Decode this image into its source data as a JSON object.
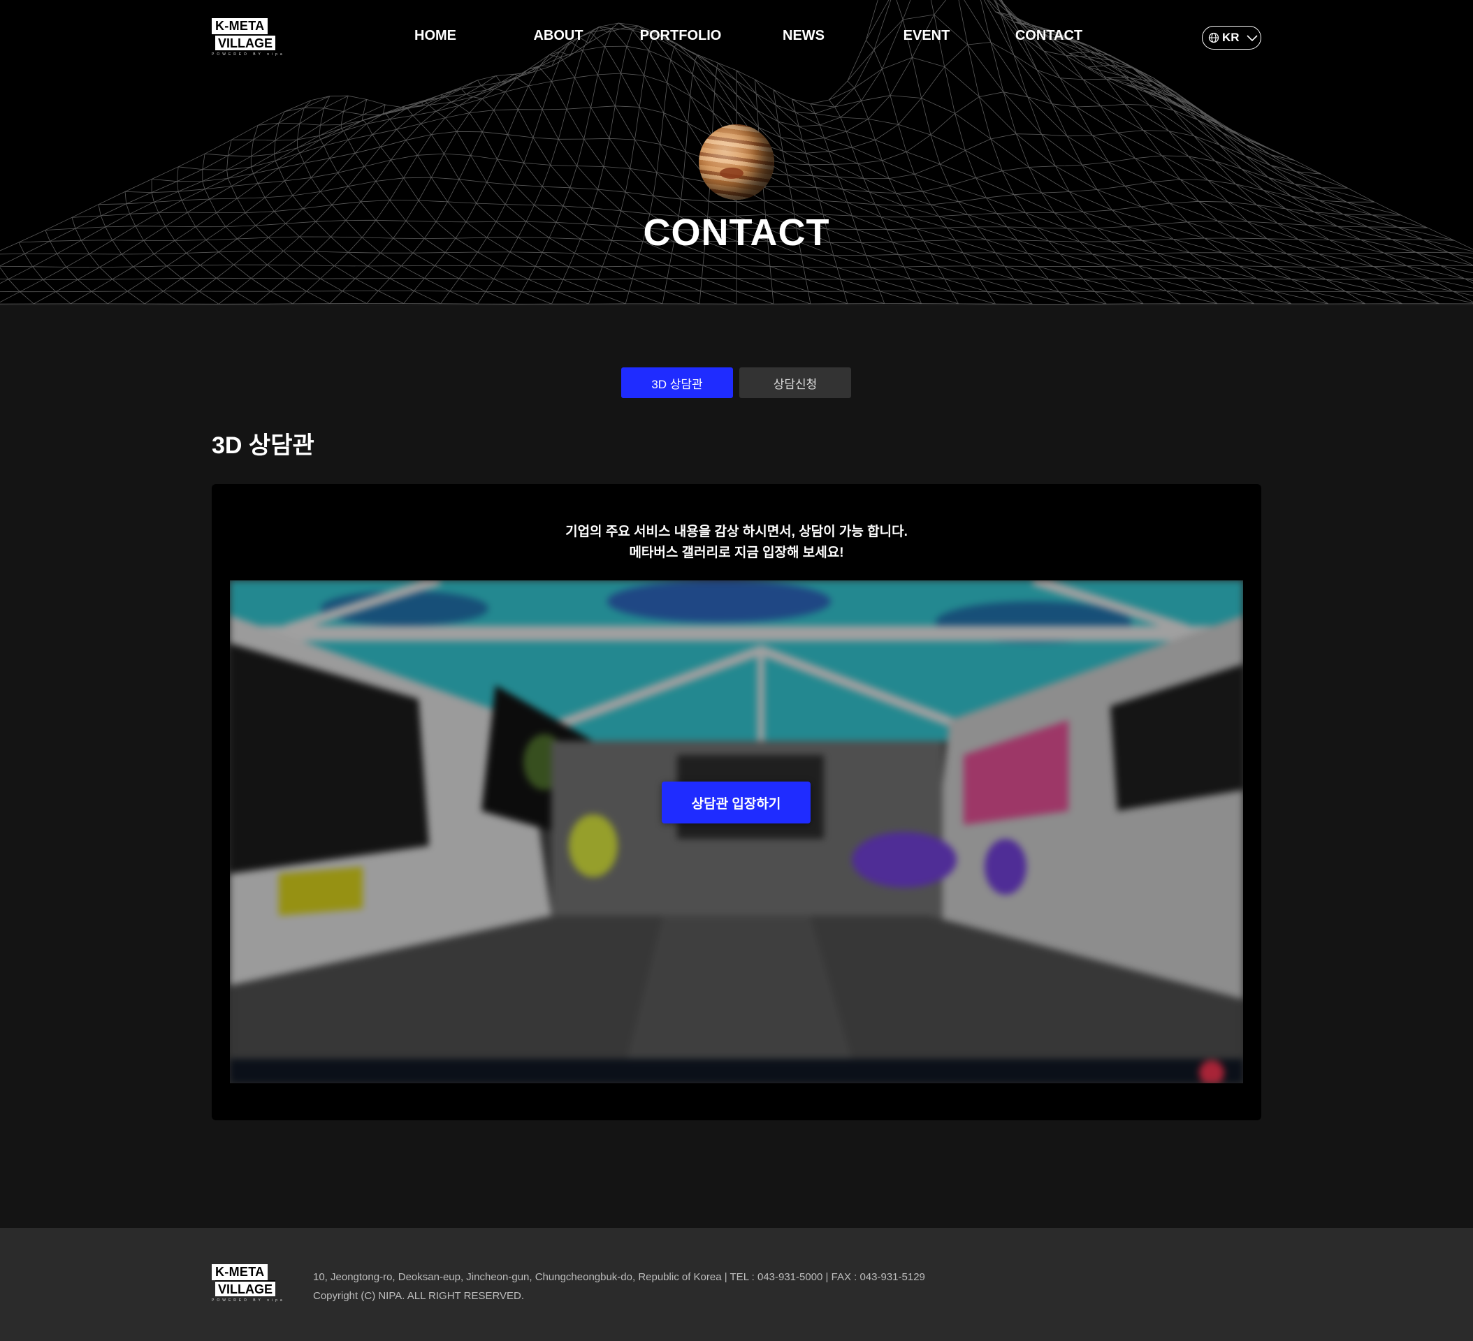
{
  "header": {
    "logo": {
      "line1": "K-META",
      "line2": "VILLAGE",
      "tagline": "POWERED BY nipa"
    },
    "nav": [
      "HOME",
      "ABOUT",
      "PORTFOLIO",
      "NEWS",
      "EVENT",
      "CONTACT"
    ],
    "language": "KR"
  },
  "hero": {
    "title": "CONTACT"
  },
  "tabs": [
    {
      "label": "3D 상담관",
      "active": true
    },
    {
      "label": "상담신청",
      "active": false
    }
  ],
  "section": {
    "title": "3D 상담관",
    "description_line1": "기업의 주요 서비스 내용을 감상 하시면서, 상담이 가능 합니다.",
    "description_line2": "메타버스 갤러리로 지금 입장해 보세요!",
    "enter_button": "상담관 입장하기"
  },
  "footer": {
    "address": "10, Jeongtong-ro, Deoksan-eup, Jincheon-gun, Chungcheongbuk-do, Republic of Korea | TEL : 043-931-5000 | FAX : 043-931-5129",
    "copyright": "Copyright (C) NIPA. ALL RIGHT RESERVED."
  },
  "colors": {
    "accent": "#1f2cff",
    "background": "#141414",
    "footer": "#2b2b2b"
  }
}
